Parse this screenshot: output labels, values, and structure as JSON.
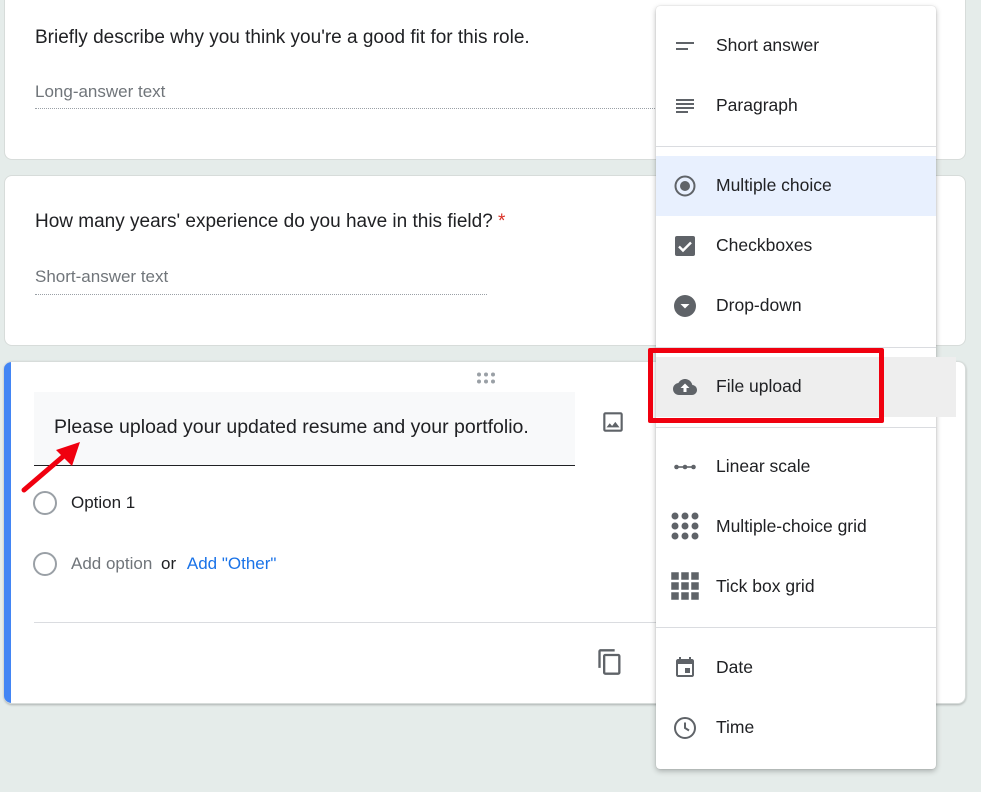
{
  "question1": {
    "title": "Briefly describe why you think you're a good fit for this role.",
    "answer_placeholder": "Long-answer text"
  },
  "question2": {
    "title": "How many years' experience do you have in this field?",
    "required_marker": "*",
    "answer_placeholder": "Short-answer text"
  },
  "question3": {
    "title": "Please upload your updated resume and your portfolio.",
    "option1": "Option 1",
    "add_option": "Add option",
    "or_text": "or",
    "add_other": "Add \"Other\""
  },
  "type_menu": {
    "items": [
      {
        "label": "Short answer",
        "icon": "short-text-icon"
      },
      {
        "label": "Paragraph",
        "icon": "paragraph-icon"
      },
      {
        "label": "Multiple choice",
        "icon": "radio-button-icon",
        "selected": true
      },
      {
        "label": "Checkboxes",
        "icon": "checkbox-icon"
      },
      {
        "label": "Drop-down",
        "icon": "dropdown-circle-icon"
      },
      {
        "label": "File upload",
        "icon": "cloud-upload-icon",
        "hovered": true
      },
      {
        "label": "Linear scale",
        "icon": "linear-scale-icon"
      },
      {
        "label": "Multiple-choice grid",
        "icon": "dot-grid-icon"
      },
      {
        "label": "Tick box grid",
        "icon": "square-grid-icon"
      },
      {
        "label": "Date",
        "icon": "calendar-icon"
      },
      {
        "label": "Time",
        "icon": "clock-icon"
      }
    ]
  },
  "colors": {
    "accent": "#4285f4",
    "link": "#1a73e8",
    "required": "#d93025",
    "annotation": "#f0000f",
    "selected_bg": "#e8f0fe",
    "icon": "#5f6368"
  }
}
